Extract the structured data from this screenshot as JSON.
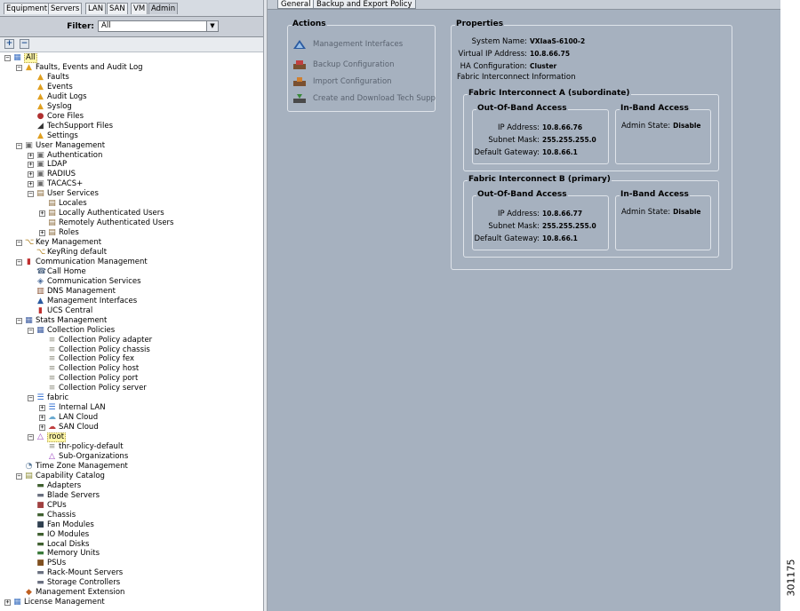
{
  "nav_tabs": [
    "Equipment",
    "Servers",
    "LAN",
    "SAN",
    "VM",
    "Admin"
  ],
  "active_nav_tab": "Admin",
  "filter": {
    "label": "Filter:",
    "value": "All"
  },
  "tree": [
    {
      "d": 0,
      "e": "-",
      "i": "all",
      "t": "All",
      "sel": true
    },
    {
      "d": 1,
      "e": "-",
      "i": "warn",
      "t": "Faults, Events and Audit Log"
    },
    {
      "d": 2,
      "e": "",
      "i": "warn",
      "t": "Faults"
    },
    {
      "d": 2,
      "e": "",
      "i": "warn",
      "t": "Events"
    },
    {
      "d": 2,
      "e": "",
      "i": "warn",
      "t": "Audit Logs"
    },
    {
      "d": 2,
      "e": "",
      "i": "warn",
      "t": "Syslog"
    },
    {
      "d": 2,
      "e": "",
      "i": "core",
      "t": "Core Files"
    },
    {
      "d": 2,
      "e": "",
      "i": "plug",
      "t": "TechSupport Files"
    },
    {
      "d": 2,
      "e": "",
      "i": "warn",
      "t": "Settings"
    },
    {
      "d": 1,
      "e": "-",
      "i": "lock",
      "t": "User Management"
    },
    {
      "d": 2,
      "e": "+",
      "i": "lock",
      "t": "Authentication"
    },
    {
      "d": 2,
      "e": "+",
      "i": "lock",
      "t": "LDAP"
    },
    {
      "d": 2,
      "e": "+",
      "i": "lock",
      "t": "RADIUS"
    },
    {
      "d": 2,
      "e": "+",
      "i": "lock",
      "t": "TACACS+"
    },
    {
      "d": 2,
      "e": "-",
      "i": "users",
      "t": "User Services"
    },
    {
      "d": 3,
      "e": "",
      "i": "users",
      "t": "Locales"
    },
    {
      "d": 3,
      "e": "+",
      "i": "users",
      "t": "Locally Authenticated Users"
    },
    {
      "d": 3,
      "e": "",
      "i": "users",
      "t": "Remotely Authenticated Users"
    },
    {
      "d": 3,
      "e": "+",
      "i": "users",
      "t": "Roles"
    },
    {
      "d": 1,
      "e": "-",
      "i": "key",
      "t": "Key Management"
    },
    {
      "d": 2,
      "e": "",
      "i": "key",
      "t": "KeyRing default"
    },
    {
      "d": 1,
      "e": "-",
      "i": "comm",
      "t": "Communication Management"
    },
    {
      "d": 2,
      "e": "",
      "i": "phone",
      "t": "Call Home"
    },
    {
      "d": 2,
      "e": "",
      "i": "net",
      "t": "Communication Services"
    },
    {
      "d": 2,
      "e": "",
      "i": "dns",
      "t": "DNS Management"
    },
    {
      "d": 2,
      "e": "",
      "i": "tri",
      "t": "Management Interfaces"
    },
    {
      "d": 2,
      "e": "",
      "i": "comm",
      "t": "UCS Central"
    },
    {
      "d": 1,
      "e": "-",
      "i": "stats",
      "t": "Stats Management"
    },
    {
      "d": 2,
      "e": "-",
      "i": "stats",
      "t": "Collection Policies"
    },
    {
      "d": 3,
      "e": "",
      "i": "policy",
      "t": "Collection Policy adapter"
    },
    {
      "d": 3,
      "e": "",
      "i": "policy",
      "t": "Collection Policy chassis"
    },
    {
      "d": 3,
      "e": "",
      "i": "policy",
      "t": "Collection Policy fex"
    },
    {
      "d": 3,
      "e": "",
      "i": "policy",
      "t": "Collection Policy host"
    },
    {
      "d": 3,
      "e": "",
      "i": "policy",
      "t": "Collection Policy port"
    },
    {
      "d": 3,
      "e": "",
      "i": "policy",
      "t": "Collection Policy server"
    },
    {
      "d": 2,
      "e": "-",
      "i": "fabric",
      "t": "fabric"
    },
    {
      "d": 3,
      "e": "+",
      "i": "fabric",
      "t": "Internal LAN"
    },
    {
      "d": 3,
      "e": "+",
      "i": "cloud",
      "t": "LAN Cloud"
    },
    {
      "d": 3,
      "e": "+",
      "i": "scloud",
      "t": "SAN Cloud"
    },
    {
      "d": 2,
      "e": "-",
      "i": "org",
      "t": "root",
      "sel": true
    },
    {
      "d": 3,
      "e": "",
      "i": "policy",
      "t": "thr-policy-default"
    },
    {
      "d": 3,
      "e": "",
      "i": "org",
      "t": "Sub-Organizations"
    },
    {
      "d": 1,
      "e": "",
      "i": "tz",
      "t": "Time Zone Management"
    },
    {
      "d": 1,
      "e": "-",
      "i": "cat",
      "t": "Capability Catalog"
    },
    {
      "d": 2,
      "e": "",
      "i": "hw",
      "t": "Adapters"
    },
    {
      "d": 2,
      "e": "",
      "i": "blade",
      "t": "Blade Servers"
    },
    {
      "d": 2,
      "e": "",
      "i": "cpu",
      "t": "CPUs"
    },
    {
      "d": 2,
      "e": "",
      "i": "hw",
      "t": "Chassis"
    },
    {
      "d": 2,
      "e": "",
      "i": "fan",
      "t": "Fan Modules"
    },
    {
      "d": 2,
      "e": "",
      "i": "hw",
      "t": "IO Modules"
    },
    {
      "d": 2,
      "e": "",
      "i": "hw",
      "t": "Local Disks"
    },
    {
      "d": 2,
      "e": "",
      "i": "mem",
      "t": "Memory Units"
    },
    {
      "d": 2,
      "e": "",
      "i": "psu",
      "t": "PSUs"
    },
    {
      "d": 2,
      "e": "",
      "i": "blade",
      "t": "Rack-Mount Servers"
    },
    {
      "d": 2,
      "e": "",
      "i": "blade",
      "t": "Storage Controllers"
    },
    {
      "d": 1,
      "e": "",
      "i": "ext",
      "t": "Management Extension"
    },
    {
      "d": 0,
      "e": "+",
      "i": "lic",
      "t": "License Management"
    }
  ],
  "icon_colors": {
    "all": "#3a6fc2",
    "warn": "#e0a020",
    "core": "#b03030",
    "plug": "#333333",
    "lock": "#6a6a6a",
    "users": "#8a6a3a",
    "key": "#b08020",
    "comm": "#c03030",
    "phone": "#5a6f8a",
    "net": "#4a6a9a",
    "dns": "#8a5030",
    "tri": "#2a5aa0",
    "stats": "#3a5aa0",
    "policy": "#8a8a7a",
    "fabric": "#2a6ad0",
    "cloud": "#6aaad0",
    "scloud": "#c04040",
    "org": "#9a40c0",
    "tz": "#5a7a9a",
    "cat": "#8a8a30",
    "hw": "#406030",
    "blade": "#6a7080",
    "cpu": "#a04040",
    "fan": "#304050",
    "mem": "#3a7a3a",
    "psu": "#805020",
    "ext": "#c06020",
    "lic": "#3a70c0"
  },
  "content_tabs": [
    "General",
    "Backup and Export Policy"
  ],
  "actions": {
    "title": "Actions",
    "items": [
      {
        "label": "Management Interfaces",
        "icon": "triangle-icon"
      },
      {
        "label": "Backup Configuration",
        "icon": "backup-icon"
      },
      {
        "label": "Import Configuration",
        "icon": "import-icon"
      },
      {
        "label": "Create and Download Tech Supp",
        "icon": "download-icon"
      }
    ]
  },
  "properties": {
    "title": "Properties",
    "system_name_label": "System Name:",
    "system_name": "VXIaaS-6100-2",
    "virtual_ip_label": "Virtual IP Address:",
    "virtual_ip": "10.8.66.75",
    "ha_label": "HA Configuration:",
    "ha_value": "Cluster",
    "fi_info": "Fabric Interconnect Information"
  },
  "fabric_a": {
    "title": "Fabric Interconnect A (subordinate)",
    "oob_title": "Out-Of-Band Access",
    "ip_label": "IP Address:",
    "ip": "10.8.66.76",
    "mask_label": "Subnet Mask:",
    "mask": "255.255.255.0",
    "gw_label": "Default Gateway:",
    "gw": "10.8.66.1",
    "inband_title": "In-Band Access",
    "admin_label": "Admin State:",
    "admin_state": "Disable"
  },
  "fabric_b": {
    "title": "Fabric Interconnect B (primary)",
    "oob_title": "Out-Of-Band Access",
    "ip_label": "IP Address:",
    "ip": "10.8.66.77",
    "mask_label": "Subnet Mask:",
    "mask": "255.255.255.0",
    "gw_label": "Default Gateway:",
    "gw": "10.8.66.1",
    "inband_title": "In-Band Access",
    "admin_label": "Admin State:",
    "admin_state": "Disable"
  },
  "figure_id": "301175"
}
